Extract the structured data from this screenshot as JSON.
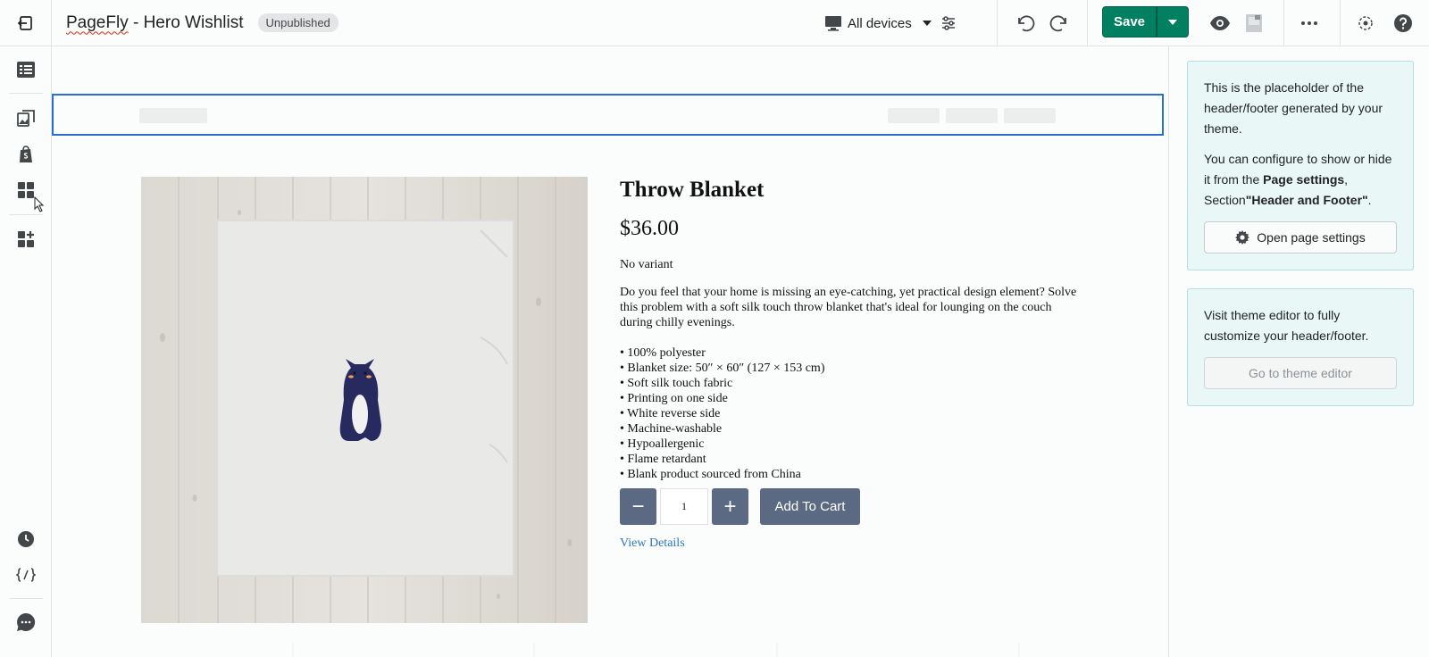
{
  "topbar": {
    "page_title_brand": "PageFly",
    "page_title_rest": " - Hero Wishlist",
    "status_badge": "Unpublished",
    "device_selector": "All devices",
    "save_label": "Save"
  },
  "icons": {
    "exit": "exit-icon",
    "device": "monitor-icon",
    "settings": "sliders-icon",
    "undo": "undo-icon",
    "redo": "redo-icon",
    "preview": "eye-icon",
    "more": "more-horizontal-icon",
    "help": "help-icon"
  },
  "sidebar": {
    "items": [
      "layers-icon",
      "media-icon",
      "shopify-icon",
      "elements-icon",
      "add-section-icon",
      "history-icon",
      "code-icon",
      "chat-icon"
    ]
  },
  "product": {
    "title": "Throw Blanket",
    "price": "$36.00",
    "variant": "No variant",
    "description": "Do you feel that your home is missing an eye-catching, yet practical design element? Solve this problem with a soft silk touch throw blanket that's ideal for lounging on the couch during chilly evenings.",
    "bullets": [
      "• 100% polyester",
      "• Blanket size: 50″ × 60″ (127 × 153 cm)",
      "• Soft silk touch fabric",
      "• Printing on one side",
      "• White reverse side",
      "• Machine-washable",
      "• Hypoallergenic",
      "• Flame retardant",
      "• Blank product sourced from China"
    ],
    "quantity": "1",
    "minus_label": "−",
    "plus_label": "+",
    "add_to_cart": "Add To Cart",
    "view_details": "View Details"
  },
  "right_panel": {
    "card1_p1": "This is the placeholder of the header/footer generated by your theme.",
    "card1_p2_a": "You can configure to show or hide it from the ",
    "card1_p2_b": "Page settings",
    "card1_p2_c": ", Section",
    "card1_p2_d": "\"Header and Footer\"",
    "card1_p2_e": ".",
    "card1_button": "Open page settings",
    "card2_p1": "Visit theme editor to fully customize your header/footer.",
    "card2_button": "Go to theme editor"
  },
  "colors": {
    "save_green": "#008060",
    "selection_blue": "#2c6ecb",
    "button_slate": "#5b6982",
    "link_blue": "#2c78c0",
    "info_card_bg": "#e9f7f7"
  }
}
